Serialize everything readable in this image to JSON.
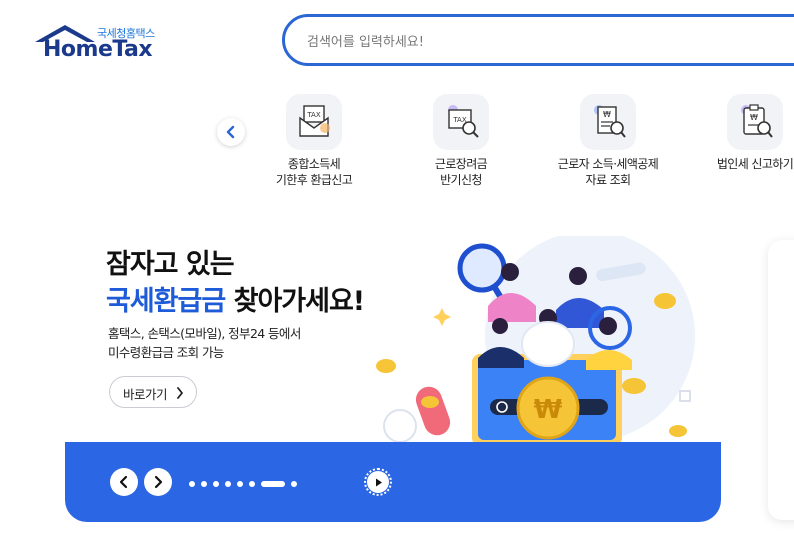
{
  "header": {
    "logo_kr": "국세청홈택스",
    "logo_en": "HomeTax",
    "search_placeholder": "검색어를 입력하세요!"
  },
  "quick_menu": {
    "prev_icon": "chevron-left-icon",
    "items": [
      {
        "label": "종합소득세\n기한후 환급신고",
        "icon": "tax-envelope-icon"
      },
      {
        "label": "근로장려금\n반기신청",
        "icon": "tax-document-search-icon"
      },
      {
        "label": "근로자 소득·세액공제\n자료 조회",
        "icon": "won-receipt-search-icon"
      },
      {
        "label": "법인세 신고하기",
        "icon": "won-clipboard-search-icon"
      }
    ]
  },
  "hero": {
    "title_line1": "잠자고 있는",
    "title_line2_highlight": "국세환급금",
    "title_line2_rest": " 찾아가세요!",
    "description": "홈택스, 손택스(모바일), 정부24 등에서\n미수령환급금 조회 가능",
    "button_label": "바로가기",
    "accent_color": "#1d5bd8"
  },
  "slider": {
    "prev_icon": "chevron-left-icon",
    "next_icon": "chevron-right-icon",
    "dot_count": 9,
    "active_index": 6,
    "play_icon": "play-icon",
    "bar_color": "#2b66e4"
  }
}
